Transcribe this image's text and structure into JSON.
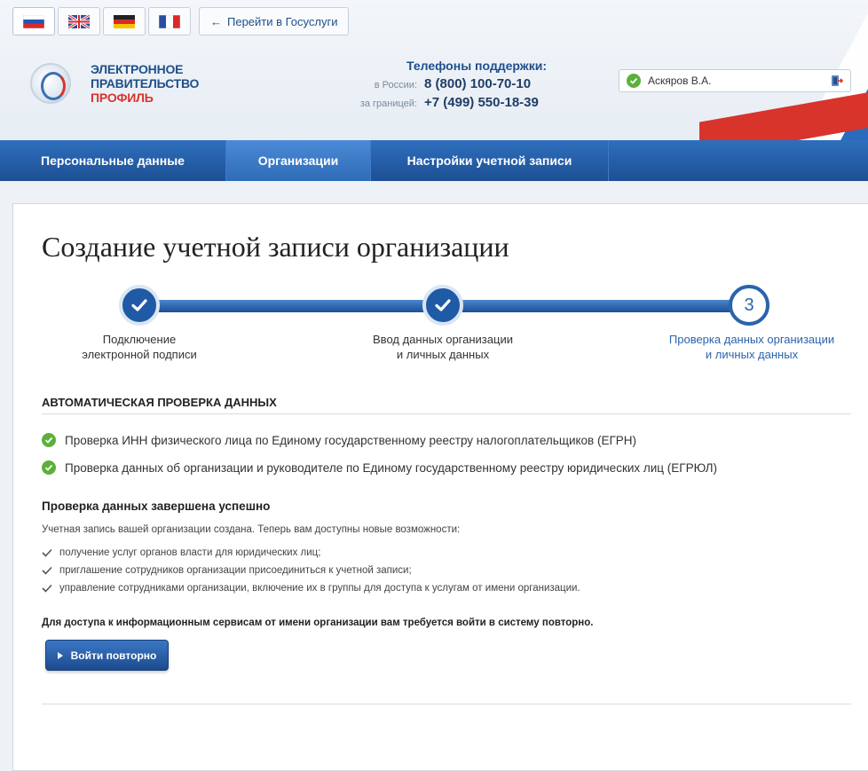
{
  "header": {
    "languages": [
      {
        "name": "russian",
        "active": true
      },
      {
        "name": "english",
        "active": false
      },
      {
        "name": "german",
        "active": false
      },
      {
        "name": "french",
        "active": false
      }
    ],
    "goto_label": "Перейти в Госуслуги",
    "logo": {
      "line1": "ЭЛЕКТРОННОЕ",
      "line2": "ПРАВИТЕЛЬСТВО",
      "line3": "ПРОФИЛЬ"
    },
    "phones": {
      "title": "Телефоны поддержки:",
      "russia_label": "в России:",
      "russia_number": "8 (800) 100-70-10",
      "abroad_label": "за границей:",
      "abroad_number": "+7 (499) 550-18-39"
    },
    "user_name": "Аскяров В.А.",
    "colors": {
      "brand_blue": "#1f4f8c",
      "brand_red": "#d8342c",
      "success_green": "#5cb03a"
    }
  },
  "nav": {
    "items": [
      "Персональные данные",
      "Организации",
      "Настройки учетной записи"
    ],
    "active_index": 1
  },
  "main": {
    "title": "Создание учетной записи организации",
    "steps": [
      {
        "line1": "Подключение",
        "line2": "электронной подписи",
        "state": "done"
      },
      {
        "line1": "Ввод данных организации",
        "line2": "и личных данных",
        "state": "done"
      },
      {
        "line1": "Проверка данных организации",
        "line2": "и личных данных",
        "state": "current",
        "number": "3"
      }
    ],
    "section_title": "АВТОМАТИЧЕСКАЯ ПРОВЕРКА ДАННЫХ",
    "checks": [
      "Проверка ИНН физического лица по Единому государственному реестру налогоплательщиков (ЕГРН)",
      "Проверка данных об организации и руководителе по Единому государственному реестру юридических лиц (ЕГРЮЛ)"
    ],
    "result_title": "Проверка данных завершена успешно",
    "result_text": "Учетная запись вашей организации создана. Теперь вам доступны новые возможности:",
    "features": [
      "получение услуг органов власти для юридических лиц;",
      "приглашение сотрудников организации присоединиться к учетной записи;",
      "управление сотрудниками организации, включение их в группы для доступа к услугам от имени организации."
    ],
    "note": "Для доступа к информационным сервисам от имени организации вам требуется войти в систему повторно.",
    "relogin_label": "Войти повторно"
  }
}
